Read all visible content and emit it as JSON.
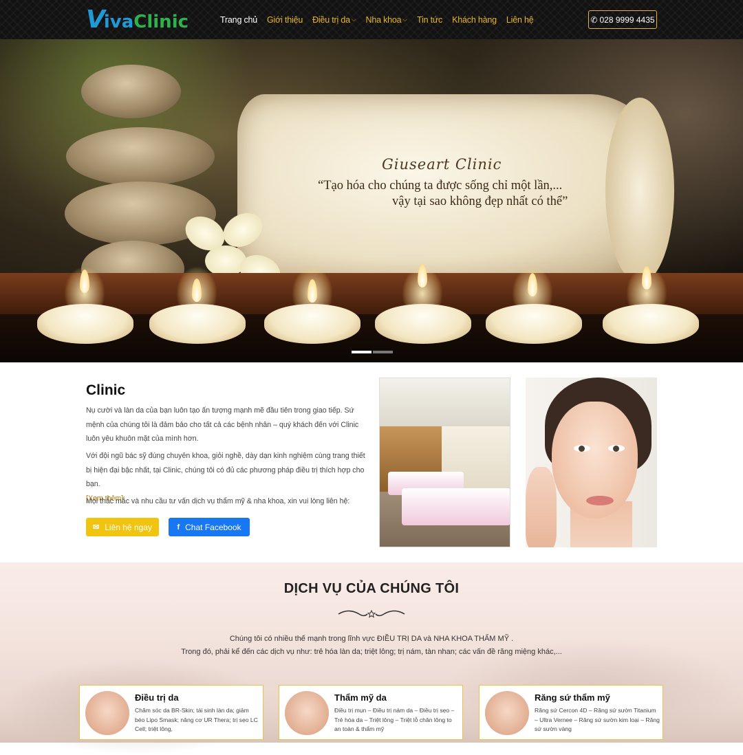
{
  "brand": {
    "logo_v": "V",
    "logo_i": "iva",
    "logo_rest": "Clinic"
  },
  "nav": {
    "items": [
      {
        "label": "Trang chủ",
        "active": true
      },
      {
        "label": "Giới thiệu"
      },
      {
        "label": "Điều trị da",
        "dropdown": true
      },
      {
        "label": "Nha khoa",
        "dropdown": true
      },
      {
        "label": "Tin tức"
      },
      {
        "label": "Khách hàng"
      },
      {
        "label": "Liên hệ"
      }
    ],
    "phone": "028 9999 4435"
  },
  "hero": {
    "signature": "Giuseart Clinic",
    "quote_line1": "“Tạo hóa cho chúng ta được sống chỉ một lần,...",
    "quote_line2": "vậy tại sao không đẹp nhất có thể”",
    "slides": 2,
    "active_slide": 1
  },
  "about": {
    "title": "Clinic",
    "p1": "Nụ cười và làn da của bạn luôn tạo ấn tượng mạnh mẽ đầu tiên trong giao tiếp. Sứ mệnh của chúng tôi là đảm bảo cho tất cả các bệnh nhân – quý khách đến với Clinic luôn yêu khuôn mặt của mình hơn.",
    "p2": "Với đội ngũ bác sỹ đúng chuyên khoa, giỏi nghề, dày dạn kinh nghiệm cùng trang thiết bị hiện đại bậc nhất, tại Clinic, chúng tôi có đủ các phương pháp điều trị thích hợp cho bạn.",
    "read_more": "[Xem thêm]",
    "p3": "Mọi thắc mắc và nhu cầu tư vấn dịch vụ thẩm mỹ & nha khoa, xin vui lòng liên hệ:",
    "btn_contact": "Liên hệ ngay",
    "btn_facebook": "Chat Facebook"
  },
  "services": {
    "title": "DỊCH VỤ CỦA CHÚNG TÔI",
    "desc_line1": "Chúng tôi có nhiều thế mạnh trong lĩnh vực  ĐIỀU TRỊ DA  và  NHA KHOA THẨM MỸ .",
    "desc_line2": "Trong đó, phải kể đến các dịch vụ như: trẻ hóa làn da; triệt lông; trị nám, tàn nhan; các vấn đề răng miệng khác,...",
    "cards": [
      {
        "title": "Điều trị da",
        "text": "Chăm sóc da BR-Skin; tái sinh làn da; giảm béo Lipo Smask; nâng cơ UR Thera; trị sẹo LC Cell; triệt lông,"
      },
      {
        "title": "Thẩm mỹ da",
        "text": "Điều trị mụn – Điều trị nám da – Điều trị sẹo – Trẻ hóa da – Triệt lông – Triệt lỗ chân lông to an toàn & thẩm mỹ"
      },
      {
        "title": "Răng sứ thẩm mỹ",
        "text": "Răng sứ Cercon 4D – Răng sứ sườn Titanium – Ultra Vernee – Răng sứ sườn kim loại – Răng sứ sườn vàng"
      }
    ]
  },
  "colors": {
    "accent": "#e7b52a",
    "facebook": "#1877f2",
    "contact": "#f1c40f"
  }
}
